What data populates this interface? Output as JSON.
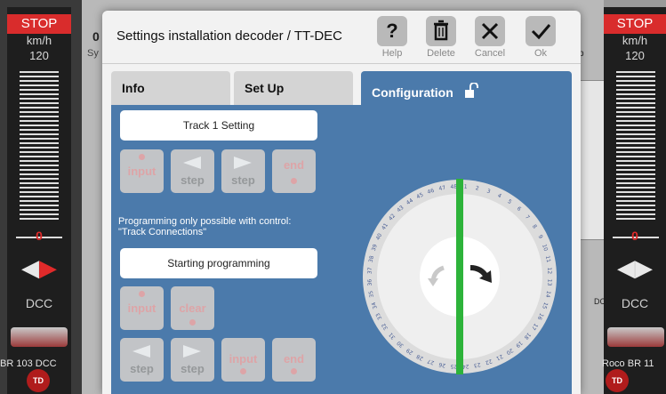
{
  "left_loco": {
    "stop": "STOP",
    "unit": "km/h",
    "max_speed": "120",
    "speed": "0",
    "protocol": "DCC",
    "name": "BR 103 DCC"
  },
  "right_loco": {
    "stop": "STOP",
    "unit": "km/h",
    "max_speed": "120",
    "speed": "0",
    "protocol": "DCC",
    "name": "Roco BR 11"
  },
  "background": {
    "sys_label": "Sy",
    "zero_label": "0",
    "dc_label": "DC",
    "p_label": "p"
  },
  "dialog": {
    "title": "Settings installation decoder / TT-DEC",
    "toolbar": {
      "help": "Help",
      "delete": "Delete",
      "cancel": "Cancel",
      "ok": "Ok"
    },
    "tabs": {
      "info": "Info",
      "setup": "Set Up",
      "configuration": "Configuration"
    },
    "track_setting": "Track 1 Setting",
    "row1": {
      "input": "input",
      "step_back": "step",
      "step_fwd": "step",
      "end": "end"
    },
    "note_line1": "Programming only possible with control:",
    "note_line2": "\"Track Connections\"",
    "start_programming": "Starting programming",
    "row2": {
      "input": "input",
      "clear": "clear"
    },
    "row3": {
      "step_back": "step",
      "step_fwd": "step",
      "input": "input",
      "end": "end"
    },
    "dial_positions": [
      "1",
      "2",
      "3",
      "4",
      "5",
      "6",
      "7",
      "8",
      "9",
      "10",
      "11",
      "12",
      "13",
      "14",
      "15",
      "16",
      "17",
      "18",
      "19",
      "20",
      "21",
      "22",
      "23",
      "24",
      "25",
      "26",
      "27",
      "28",
      "29",
      "30",
      "31",
      "32",
      "33",
      "34",
      "35",
      "36",
      "37",
      "38",
      "39",
      "40",
      "41",
      "42",
      "43",
      "44",
      "45",
      "46",
      "47",
      "48"
    ]
  },
  "colors": {
    "panel_blue": "#4b7aab",
    "stop_red": "#d92c2c",
    "track_green": "#2db33a",
    "disabled_red": "#e5a7a7"
  }
}
